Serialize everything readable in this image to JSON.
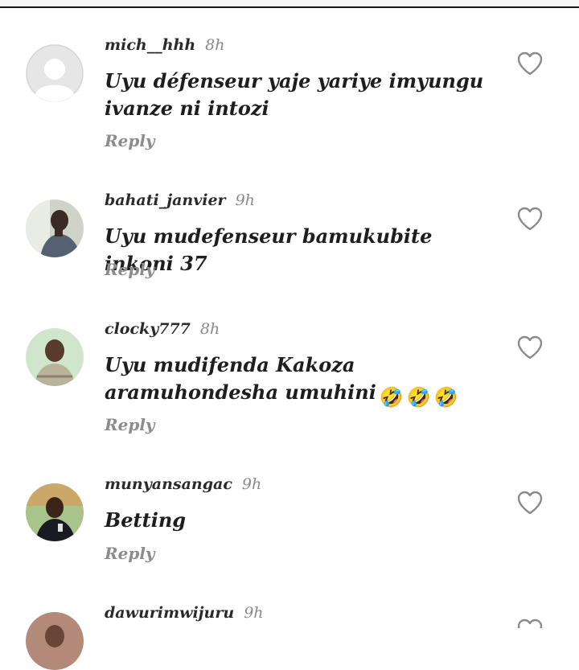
{
  "comments": [
    {
      "username": "mich__hhh",
      "time": "8h",
      "text": "Uyu défenseur yaje yariye imyungu ivanze ni intozi",
      "reply": "Reply",
      "avatar": "default-avatar"
    },
    {
      "username": "bahati_janvier",
      "time": "9h",
      "text": "Uyu mudefenseur bamukubite inkoni 37",
      "reply": "Reply",
      "avatar": "photo-avatar"
    },
    {
      "username": "clocky777",
      "time": "8h",
      "text": "Uyu mudifenda Kakoza aramuhondesha umuhini",
      "emojis": [
        "🤣",
        "🤣",
        "🤣"
      ],
      "reply": "Reply",
      "avatar": "photo-avatar"
    },
    {
      "username": "munyansangac",
      "time": "9h",
      "text": "Betting",
      "reply": "Reply",
      "avatar": "photo-avatar"
    },
    {
      "username": "dawurimwijuru",
      "time": "9h",
      "avatar": "photo-avatar"
    }
  ],
  "colors": {
    "username": "#2a2a2a",
    "time": "#8a8a8a",
    "reply": "#8c8c8c",
    "heart": "#8a8a8a"
  },
  "icons": {
    "like": "heart-outline-icon"
  }
}
